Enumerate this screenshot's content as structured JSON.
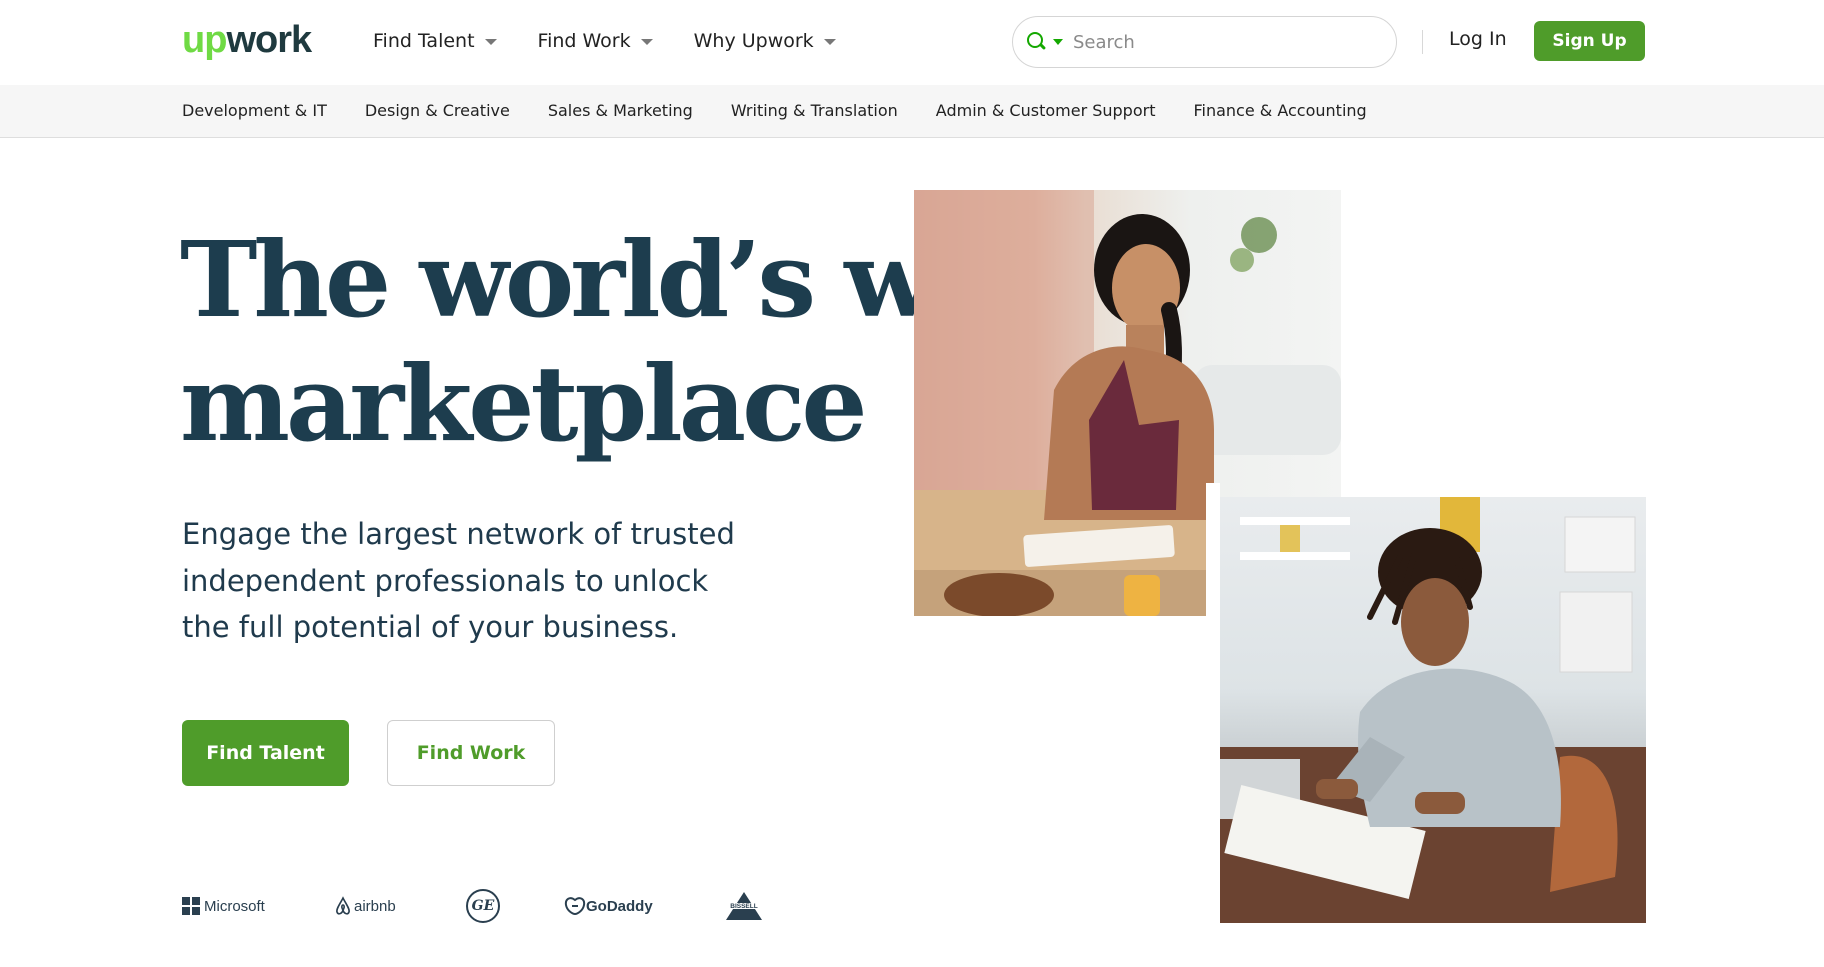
{
  "header": {
    "logo_up": "up",
    "logo_work": "work",
    "nav": [
      {
        "label": "Find Talent"
      },
      {
        "label": "Find Work"
      },
      {
        "label": "Why Upwork"
      }
    ],
    "search": {
      "placeholder": "Search",
      "value": ""
    },
    "login_label": "Log In",
    "signup_label": "Sign Up"
  },
  "categories": [
    "Development & IT",
    "Design & Creative",
    "Sales & Marketing",
    "Writing & Translation",
    "Admin & Customer Support",
    "Finance & Accounting"
  ],
  "hero": {
    "headline_line1": "The world’s work",
    "headline_line2": "marketplace",
    "subcopy": "Engage the largest network of trusted independent professionals to unlock the full potential of your business.",
    "cta_talent": "Find Talent",
    "cta_work": "Find Work"
  },
  "trusted_logos": {
    "microsoft": "Microsoft",
    "airbnb": "airbnb",
    "ge": "GE",
    "godaddy": "GoDaddy",
    "bissell": "BISSELL"
  },
  "colors": {
    "brand_green": "#4f9c2a",
    "logo_green": "#6fda44",
    "headline": "#1d3d4e"
  }
}
